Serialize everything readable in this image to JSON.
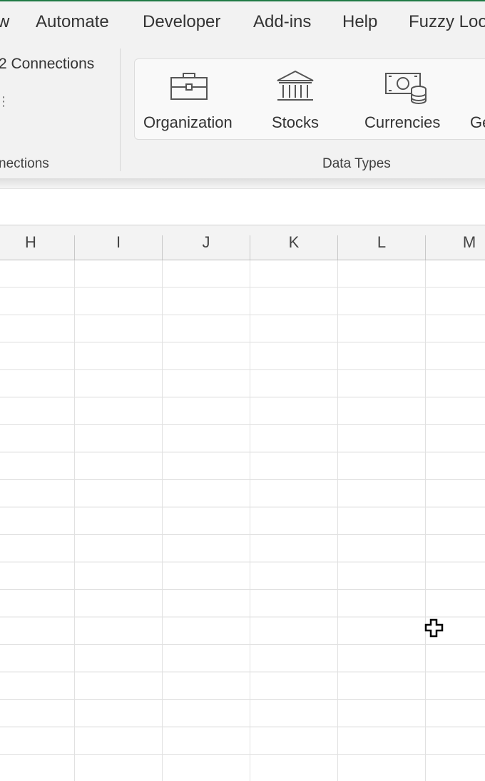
{
  "ribbon": {
    "tabs": [
      {
        "label": "w"
      },
      {
        "label": "Automate"
      },
      {
        "label": "Developer"
      },
      {
        "label": "Add-ins"
      },
      {
        "label": "Help"
      },
      {
        "label": "Fuzzy Loo"
      }
    ],
    "connections": {
      "item_label": "2 Connections",
      "group_label": "nections"
    },
    "data_types": {
      "group_label": "Data Types",
      "buttons": [
        {
          "label": "Organization",
          "icon": "briefcase-icon"
        },
        {
          "label": "Stocks",
          "icon": "bank-icon"
        },
        {
          "label": "Currencies",
          "icon": "currency-icon"
        },
        {
          "label": "Ge",
          "icon": "geography-icon"
        }
      ]
    }
  },
  "sheet": {
    "columns": [
      "H",
      "I",
      "J",
      "K",
      "L",
      "M"
    ]
  },
  "colors": {
    "accent": "#1f7a45",
    "ribbon_bg": "#f2f2f2",
    "gridline": "#e1e1e1"
  }
}
